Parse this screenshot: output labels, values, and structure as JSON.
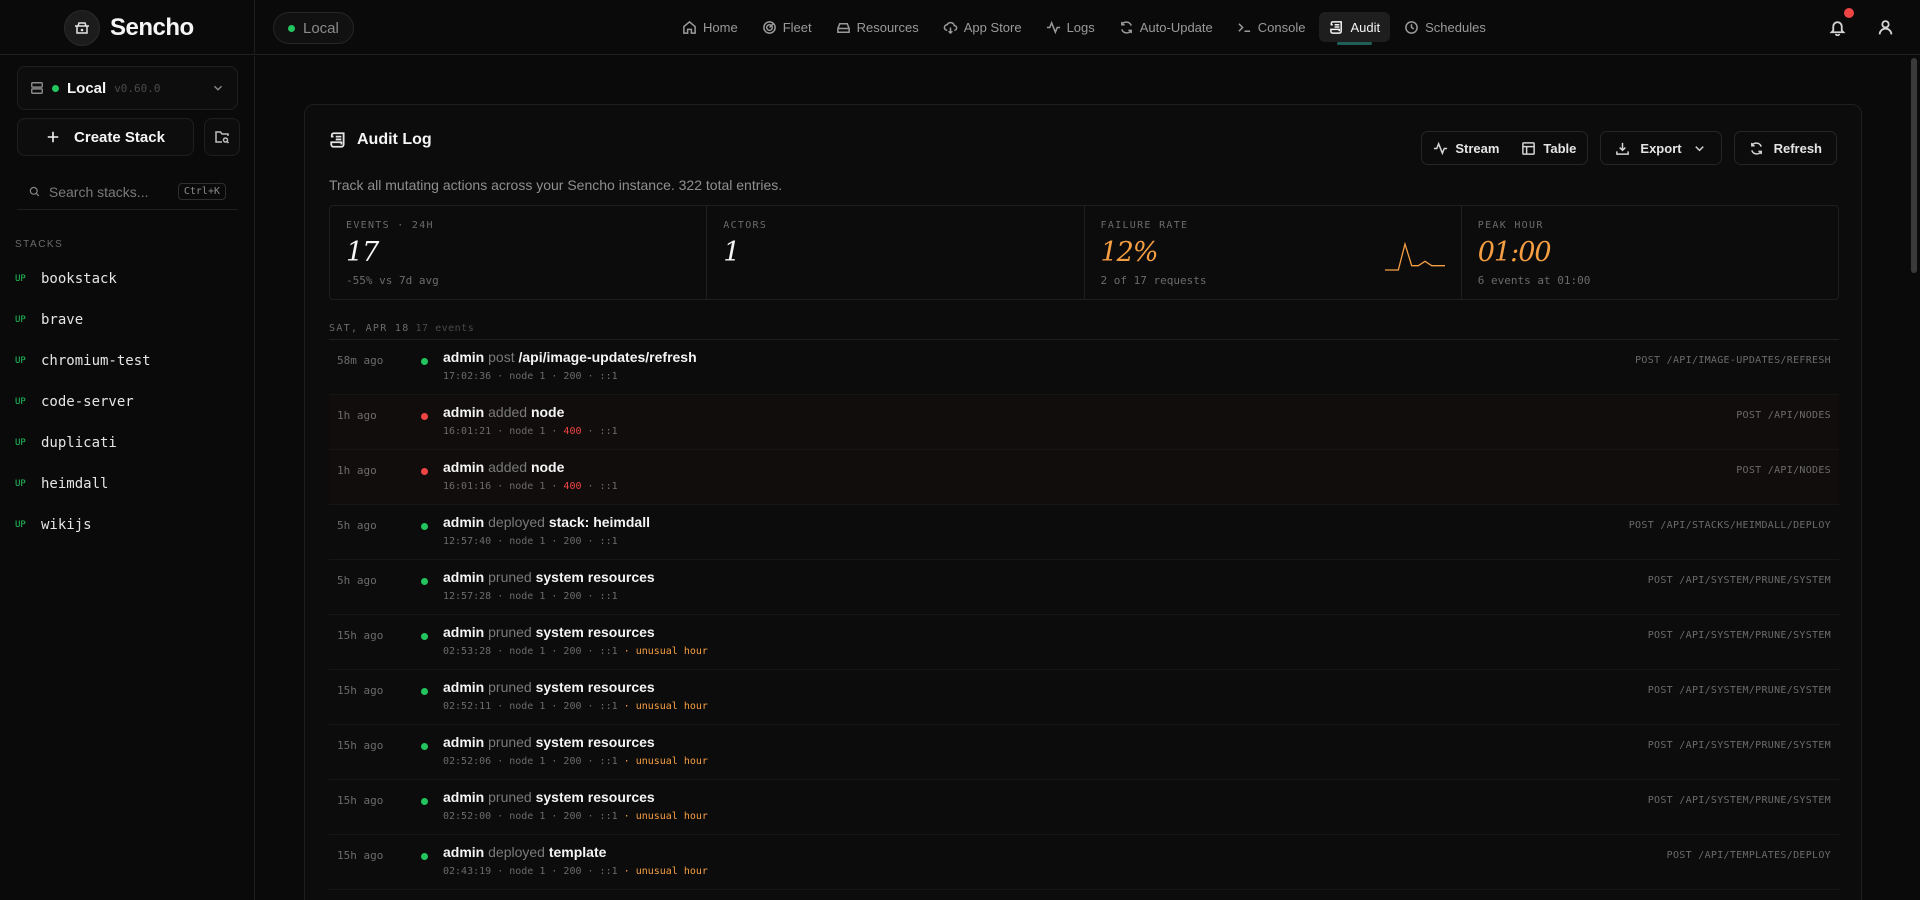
{
  "app": {
    "name": "Sencho"
  },
  "node_pill": {
    "label": "Local"
  },
  "nav": [
    {
      "label": "Home",
      "icon": "home-icon"
    },
    {
      "label": "Fleet",
      "icon": "radar-icon"
    },
    {
      "label": "Resources",
      "icon": "drive-icon"
    },
    {
      "label": "App Store",
      "icon": "cloud-download-icon"
    },
    {
      "label": "Logs",
      "icon": "activity-icon"
    },
    {
      "label": "Auto-Update",
      "icon": "refresh-icon"
    },
    {
      "label": "Console",
      "icon": "terminal-icon"
    },
    {
      "label": "Audit",
      "icon": "scroll-icon",
      "active": true
    },
    {
      "label": "Schedules",
      "icon": "clock-icon"
    }
  ],
  "sidebar": {
    "node": {
      "name": "Local",
      "version": "v0.60.0"
    },
    "create_label": "Create Stack",
    "search": {
      "placeholder": "Search stacks...",
      "shortcut": "Ctrl+K"
    },
    "stacks_label": "STACKS",
    "stacks": [
      {
        "status": "UP",
        "name": "bookstack"
      },
      {
        "status": "UP",
        "name": "brave"
      },
      {
        "status": "UP",
        "name": "chromium-test"
      },
      {
        "status": "UP",
        "name": "code-server"
      },
      {
        "status": "UP",
        "name": "duplicati"
      },
      {
        "status": "UP",
        "name": "heimdall"
      },
      {
        "status": "UP",
        "name": "wikijs"
      }
    ]
  },
  "audit": {
    "title": "Audit Log",
    "description": "Track all mutating actions across your Sencho instance. 322 total entries.",
    "buttons": {
      "stream": "Stream",
      "table": "Table",
      "export": "Export",
      "refresh": "Refresh"
    },
    "stats": [
      {
        "label": "EVENTS · 24H",
        "value": "17",
        "sub": "-55% vs 7d avg",
        "warn": false
      },
      {
        "label": "ACTORS",
        "value": "1",
        "sub": "",
        "warn": false
      },
      {
        "label": "FAILURE RATE",
        "value": "12%",
        "sub": "2 of 17 requests",
        "warn": true
      },
      {
        "label": "PEAK HOUR",
        "value": "01:00",
        "sub": "6 events at 01:00",
        "warn": true
      }
    ],
    "sparkline_values": [
      0,
      0,
      0,
      6,
      1,
      1,
      2,
      1,
      1,
      1
    ],
    "day": {
      "label": "SAT, APR 18",
      "count": "17 events"
    },
    "events": [
      {
        "ago": "58m ago",
        "actor": "admin",
        "verb": "post",
        "target": "/api/image-updates/refresh",
        "time": "17:02:36",
        "node": "node 1",
        "code": "200",
        "ip": "::1",
        "error": false,
        "unusual": "",
        "route": "POST /API/IMAGE-UPDATES/REFRESH"
      },
      {
        "ago": "1h ago",
        "actor": "admin",
        "verb": "added",
        "target": "node",
        "time": "16:01:21",
        "node": "node 1",
        "code": "400",
        "ip": "::1",
        "error": true,
        "unusual": "",
        "route": "POST /API/NODES"
      },
      {
        "ago": "1h ago",
        "actor": "admin",
        "verb": "added",
        "target": "node",
        "time": "16:01:16",
        "node": "node 1",
        "code": "400",
        "ip": "::1",
        "error": true,
        "unusual": "",
        "route": "POST /API/NODES"
      },
      {
        "ago": "5h ago",
        "actor": "admin",
        "verb": "deployed",
        "target": "stack: heimdall",
        "time": "12:57:40",
        "node": "node 1",
        "code": "200",
        "ip": "::1",
        "error": false,
        "unusual": "",
        "route": "POST /API/STACKS/HEIMDALL/DEPLOY"
      },
      {
        "ago": "5h ago",
        "actor": "admin",
        "verb": "pruned",
        "target": "system resources",
        "time": "12:57:28",
        "node": "node 1",
        "code": "200",
        "ip": "::1",
        "error": false,
        "unusual": "",
        "route": "POST /API/SYSTEM/PRUNE/SYSTEM"
      },
      {
        "ago": "15h ago",
        "actor": "admin",
        "verb": "pruned",
        "target": "system resources",
        "time": "02:53:28",
        "node": "node 1",
        "code": "200",
        "ip": "::1",
        "error": false,
        "unusual": "unusual hour",
        "route": "POST /API/SYSTEM/PRUNE/SYSTEM"
      },
      {
        "ago": "15h ago",
        "actor": "admin",
        "verb": "pruned",
        "target": "system resources",
        "time": "02:52:11",
        "node": "node 1",
        "code": "200",
        "ip": "::1",
        "error": false,
        "unusual": "unusual hour",
        "route": "POST /API/SYSTEM/PRUNE/SYSTEM"
      },
      {
        "ago": "15h ago",
        "actor": "admin",
        "verb": "pruned",
        "target": "system resources",
        "time": "02:52:06",
        "node": "node 1",
        "code": "200",
        "ip": "::1",
        "error": false,
        "unusual": "unusual hour",
        "route": "POST /API/SYSTEM/PRUNE/SYSTEM"
      },
      {
        "ago": "15h ago",
        "actor": "admin",
        "verb": "pruned",
        "target": "system resources",
        "time": "02:52:00",
        "node": "node 1",
        "code": "200",
        "ip": "::1",
        "error": false,
        "unusual": "unusual hour",
        "route": "POST /API/SYSTEM/PRUNE/SYSTEM"
      },
      {
        "ago": "15h ago",
        "actor": "admin",
        "verb": "deployed",
        "target": "template",
        "time": "02:43:19",
        "node": "node 1",
        "code": "200",
        "ip": "::1",
        "error": false,
        "unusual": "unusual hour",
        "route": "POST /API/TEMPLATES/DEPLOY"
      }
    ]
  },
  "colors": {
    "success": "#22c55e",
    "error": "#ef4444",
    "warning": "#f59e42",
    "background": "#0a0a0a"
  }
}
